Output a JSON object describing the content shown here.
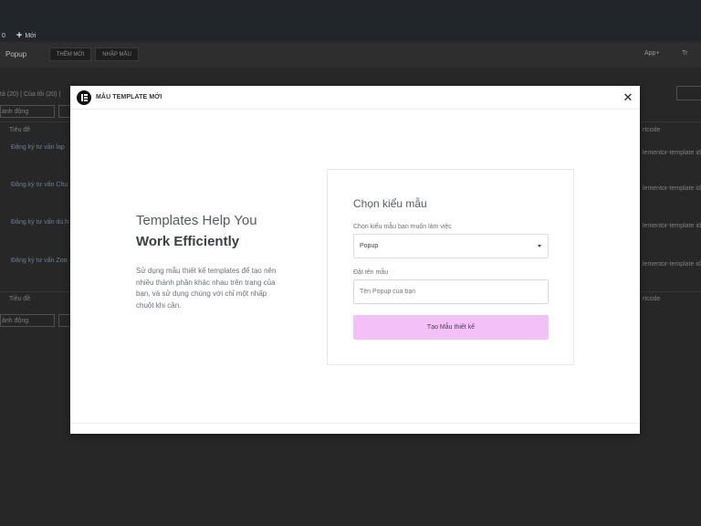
{
  "admin_bar": {
    "counter": "0",
    "new_label": "Mới"
  },
  "page": {
    "title": "Popup",
    "add_new_label": "THÊM MỚI",
    "import_label": "NHẬP MẪU",
    "apps_label": "App+",
    "trailing_label": "Tr",
    "filter_links": "tả (20) | Của tôi (20) |",
    "bulk_action": "ành động",
    "col_title": "Tiêu đề",
    "col_shortcode": "rtcode",
    "rows": [
      {
        "title": "Đăng ký tư vấn lap",
        "shortcode": "lementor-template id"
      },
      {
        "title": "Đăng ký tư vấn Chu",
        "shortcode": "lementor-template id"
      },
      {
        "title": "Đăng ký tư vấn du h",
        "shortcode": "lementor-template id"
      },
      {
        "title": "Đăng ký tư vấn Zoo",
        "shortcode": "lementor-template id"
      }
    ]
  },
  "modal": {
    "title": "MẪU TEMPLATE MỚI",
    "headline_line1": "Templates Help You",
    "headline_line2": "Work Efficiently",
    "description": "Sử dụng mẫu thiết kế templates để tạo nên nhiều thành phần khác nhau trên trang của bạn, và sử dụng chúng với chỉ một nhấp chuột khi cần.",
    "card": {
      "title": "Chọn kiểu mẫu",
      "type_label": "Chọn kiểu mẫu bạn muốn làm việc",
      "type_value": "Popup",
      "name_label": "Đặt tên mẫu",
      "name_placeholder": "Tên Popup của bạn",
      "submit_label": "Tạo Mẫu thiết kế"
    },
    "accent_color": "#f3c1f7"
  }
}
